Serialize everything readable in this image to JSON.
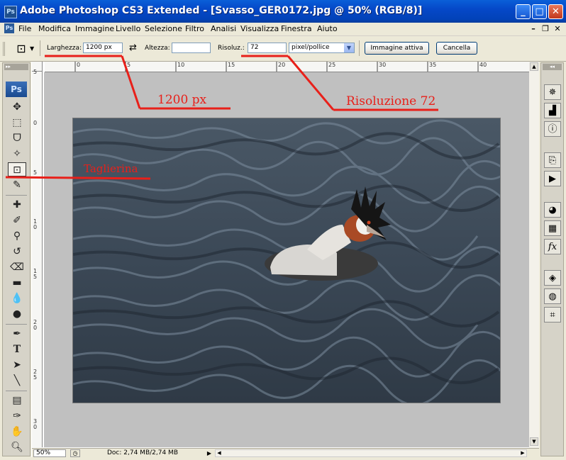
{
  "window": {
    "title": "Adobe Photoshop CS3 Extended - [Svasso_GER0172.jpg @ 50% (RGB/8)]",
    "app_icon": "Ps",
    "controls": [
      "minimize-icon",
      "maximize-icon",
      "close-icon"
    ]
  },
  "menubar": {
    "items": [
      "File",
      "Modifica",
      "Immagine",
      "Livello",
      "Selezione",
      "Filtro",
      "Analisi",
      "Visualizza",
      "Finestra",
      "Aiuto"
    ]
  },
  "options": {
    "width_label": "Larghezza:",
    "width_value": "1200 px",
    "height_label": "Altezza:",
    "height_value": "",
    "resolution_label": "Risoluz.:",
    "resolution_value": "72",
    "resolution_unit": "pixel/pollice",
    "front_image_button": "Immagine attiva",
    "clear_button": "Cancella"
  },
  "toolbox": {
    "logo": "Ps",
    "tools": [
      "move",
      "marquee",
      "lasso",
      "magic-wand",
      "crop",
      "slice",
      "healing-brush",
      "brush",
      "clone-stamp",
      "history-brush",
      "eraser",
      "gradient",
      "blur",
      "dodge",
      "pen",
      "type",
      "path-selection",
      "line",
      "notes",
      "eyedropper",
      "hand",
      "zoom"
    ]
  },
  "ruler": {
    "h_labels": [
      "0",
      "5",
      "10",
      "15",
      "20",
      "25",
      "30",
      "35",
      "40"
    ],
    "v_labels": [
      "5",
      "0",
      "5",
      "1 0",
      "1 5",
      "2 0",
      "2 5",
      "3 0"
    ]
  },
  "status": {
    "zoom": "50%",
    "doc_info": "Doc: 2,74 MB/2,74 MB"
  },
  "annotations": {
    "crop_tool": "Taglierina",
    "width": "1200 px",
    "resolution": "Risoluzione 72",
    "color": "#e8201a"
  }
}
